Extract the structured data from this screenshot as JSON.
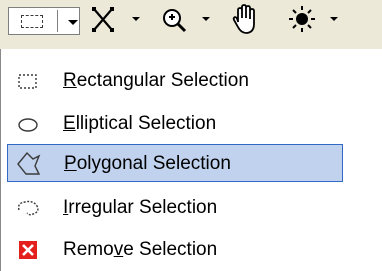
{
  "toolbar": {
    "tools": [
      {
        "icon": "rectangle-select-icon",
        "has_dropdown": true
      },
      {
        "icon": "scatter-select-icon",
        "has_dropdown": true
      },
      {
        "icon": "zoom-icon",
        "has_dropdown": true
      },
      {
        "icon": "pan-hand-icon",
        "has_dropdown": false
      },
      {
        "icon": "brightness-icon",
        "has_dropdown": true
      }
    ]
  },
  "menu": {
    "items": [
      {
        "mnemonic": "R",
        "rest": "ectangular Selection",
        "icon": "rectangle-select-icon",
        "selected": false
      },
      {
        "mnemonic": "E",
        "rest": "lliptical Selection",
        "icon": "ellipse-select-icon",
        "selected": false
      },
      {
        "mnemonic": "P",
        "rest": "olygonal Selection",
        "icon": "polygon-select-icon",
        "selected": true
      },
      {
        "mnemonic": "I",
        "rest": "rregular Selection",
        "icon": "lasso-select-icon",
        "selected": false
      },
      {
        "pre": "Remo",
        "mnemonic": "v",
        "rest": "e Selection",
        "icon": "remove-selection-icon",
        "selected": false
      }
    ]
  },
  "colors": {
    "toolbar_bg": "#ece9d8",
    "selection_bg": "#c1d2ee",
    "selection_border": "#316ac5",
    "remove_icon": "#e3201b"
  }
}
